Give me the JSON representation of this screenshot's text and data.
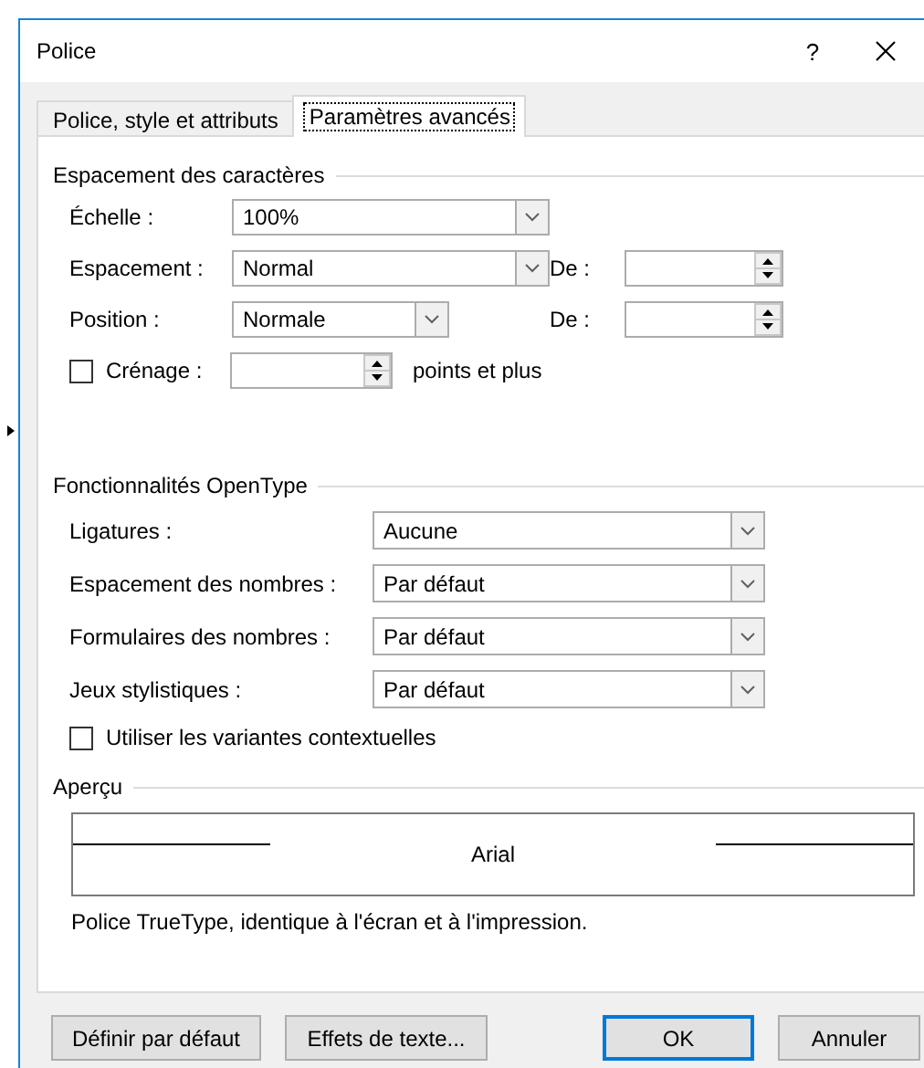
{
  "window": {
    "title": "Police",
    "help": "?"
  },
  "tabs": [
    {
      "label": "Police, style et attributs",
      "selected": false
    },
    {
      "label": "Paramètres avancés",
      "selected": true
    }
  ],
  "character_spacing": {
    "title": "Espacement des caractères",
    "scale": {
      "label": "Échelle :",
      "value": "100%"
    },
    "spacing": {
      "label": "Espacement :",
      "value": "Normal",
      "by_label": "De :"
    },
    "position": {
      "label": "Position :",
      "value": "Normale",
      "by_label": "De :"
    },
    "kerning": {
      "label": "Crénage :",
      "checked": false,
      "suffix": "points et plus"
    }
  },
  "opentype": {
    "title": "Fonctionnalités OpenType",
    "fields": [
      {
        "label": "Ligatures :",
        "value": "Aucune"
      },
      {
        "label": "Espacement des nombres :",
        "value": "Par défaut"
      },
      {
        "label": "Formulaires des nombres :",
        "value": "Par défaut"
      },
      {
        "label": "Jeux stylistiques :",
        "value": "Par défaut"
      }
    ],
    "contextual": {
      "label": "Utiliser les variantes contextuelles",
      "checked": false
    }
  },
  "preview": {
    "title": "Aperçu",
    "sample": "Arial",
    "description": "Police TrueType, identique à l'écran et à l'impression."
  },
  "buttons": [
    {
      "label": "Définir par défaut",
      "default": false
    },
    {
      "label": "Effets de texte...",
      "default": false
    },
    {
      "label": "OK",
      "default": true
    },
    {
      "label": "Annuler",
      "default": false
    }
  ]
}
